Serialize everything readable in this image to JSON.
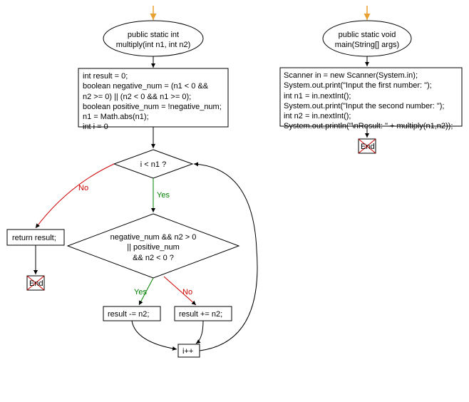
{
  "left": {
    "start": "public static int\nmultiply(int n1, int n2)",
    "init": "int result = 0;\nboolean negative_num = (n1 < 0 &&\nn2 >= 0) || (n2 < 0 && n1 >= 0);\nboolean positive_num = !negative_num;\nn1 = Math.abs(n1);\nint i = 0",
    "cond1": "i < n1 ?",
    "return": "return result;",
    "end": "End",
    "cond2": "negative_num && n2 > 0\n|| positive_num\n&& n2 < 0 ?",
    "res_minus": "result -= n2;",
    "res_plus": "result += n2;",
    "incr": "i++"
  },
  "right": {
    "start": "public static void\nmain(String[] args)",
    "body": "Scanner in = new Scanner(System.in);\nSystem.out.print(\"Input the first number: \");\nint n1 = in.nextInt();\nSystem.out.print(\"Input the second number: \");\nint n2 = in.nextInt();\nSystem.out.println(\"\\nResult: \" + multiply(n1,n2));",
    "end": "End"
  },
  "labels": {
    "yes": "Yes",
    "no": "No"
  }
}
